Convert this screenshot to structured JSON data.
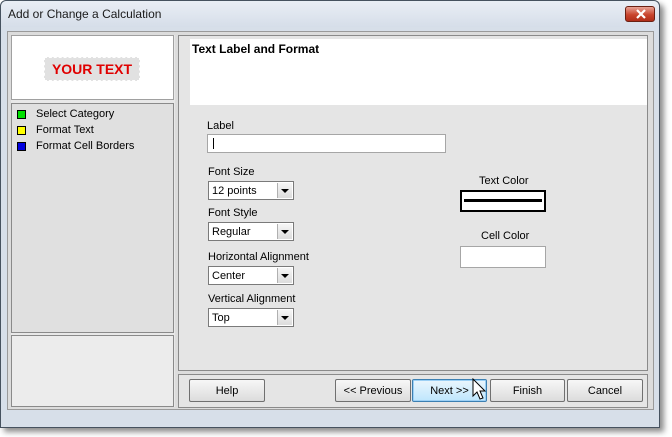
{
  "window": {
    "title": "Add or Change a Calculation"
  },
  "preview": {
    "text": "YOUR TEXT",
    "text_color": "#e00000"
  },
  "steps": [
    {
      "label": "Select Category",
      "color": "#00e000"
    },
    {
      "label": "Format Text",
      "color": "#ffff00"
    },
    {
      "label": "Format Cell Borders",
      "color": "#0000e0"
    }
  ],
  "panel": {
    "title": "Text Label and Format"
  },
  "form": {
    "label_label": "Label",
    "label_value": "",
    "font_size_label": "Font Size",
    "font_size_value": "12 points",
    "font_style_label": "Font Style",
    "font_style_value": "Regular",
    "h_align_label": "Horizontal Alignment",
    "h_align_value": "Center",
    "v_align_label": "Vertical Alignment",
    "v_align_value": "Top",
    "text_color_label": "Text Color",
    "cell_color_label": "Cell Color"
  },
  "buttons": {
    "help": "Help",
    "previous": "<< Previous",
    "next": "Next >>",
    "finish": "Finish",
    "cancel": "Cancel"
  },
  "icons": {
    "close": "close-icon",
    "dropdown": "chevron-down-icon",
    "cursor": "mouse-pointer-icon"
  }
}
